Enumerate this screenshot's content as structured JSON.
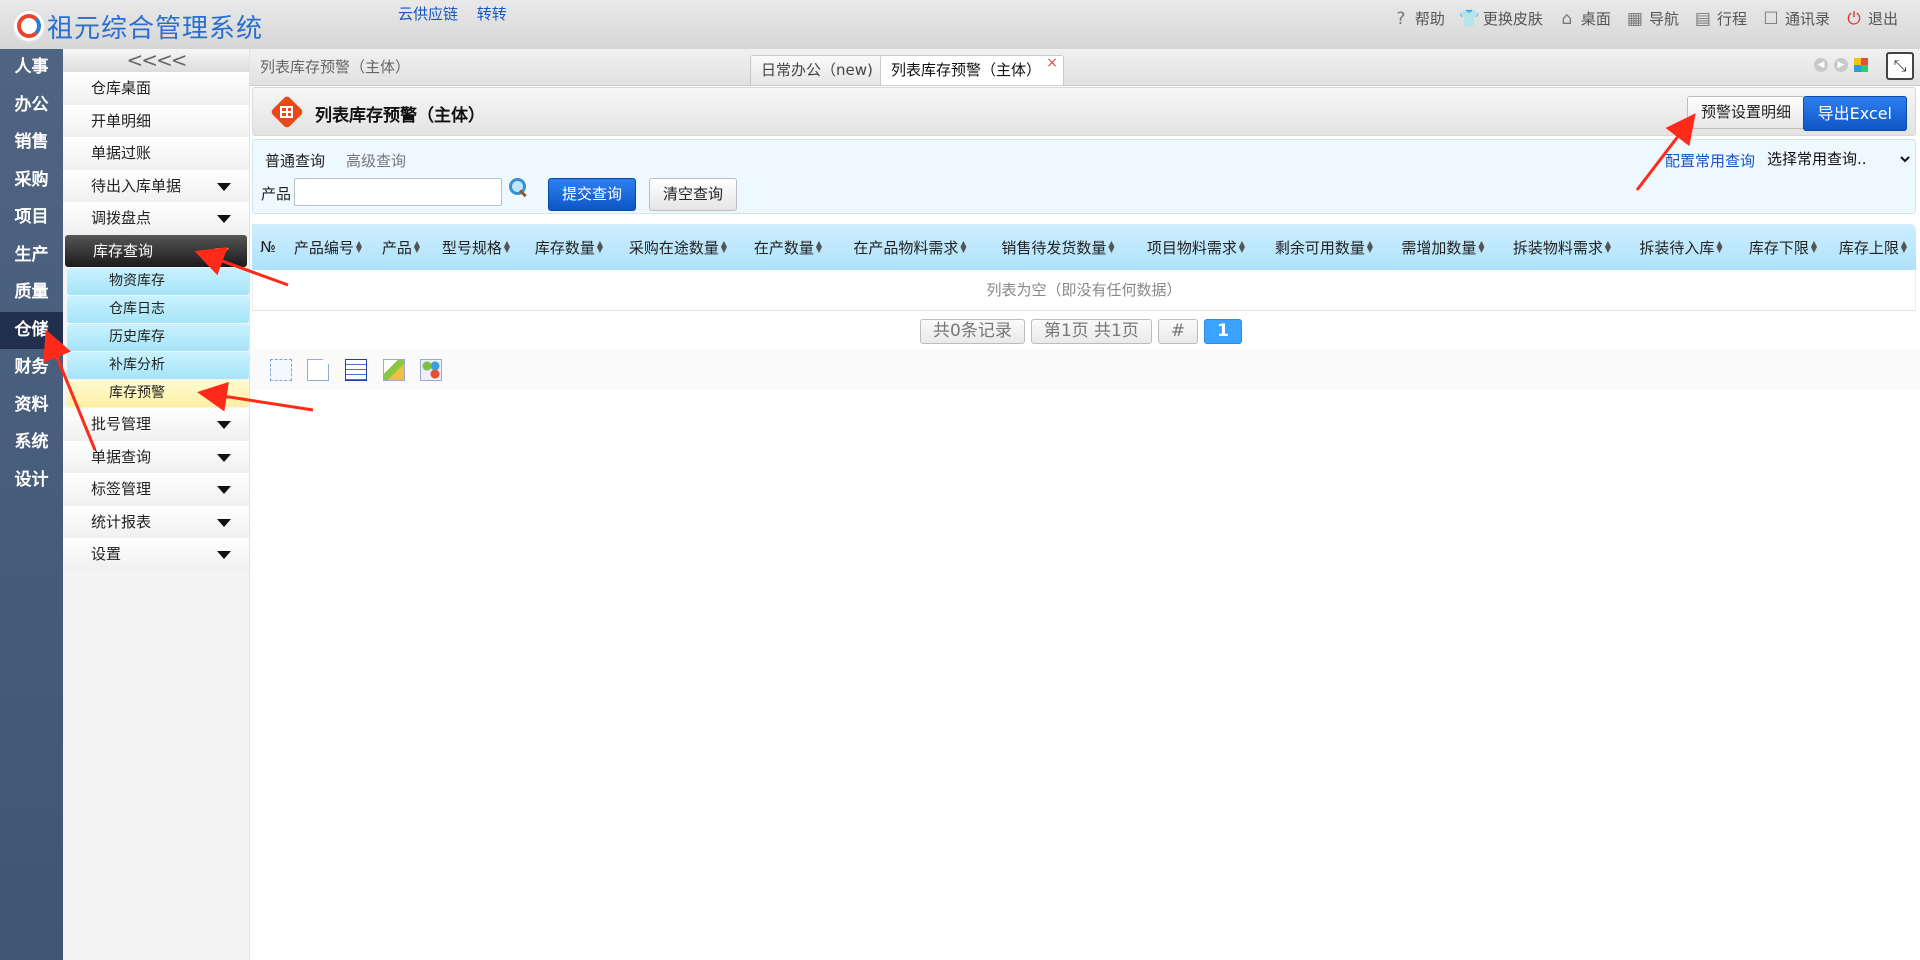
{
  "app": {
    "title": "祖元综合管理系统",
    "top_links": [
      "云供应链",
      "转转"
    ],
    "top_menu": [
      {
        "label": "帮助",
        "icon": "help-icon",
        "glyph": "?"
      },
      {
        "label": "更换皮肤",
        "icon": "shirt-icon",
        "glyph": "👕"
      },
      {
        "label": "桌面",
        "icon": "home-icon",
        "glyph": "⌂"
      },
      {
        "label": "导航",
        "icon": "nav-grid-icon",
        "glyph": "▦"
      },
      {
        "label": "行程",
        "icon": "calendar-icon",
        "glyph": "▤"
      },
      {
        "label": "通讯录",
        "icon": "contacts-icon",
        "glyph": "☐"
      },
      {
        "label": "退出",
        "icon": "power-icon",
        "glyph": "⏻"
      }
    ]
  },
  "categories": [
    "人事",
    "办公",
    "销售",
    "采购",
    "项目",
    "生产",
    "质量",
    "仓储",
    "财务",
    "资料",
    "系统",
    "设计"
  ],
  "active_category": "仓储",
  "menu": {
    "collapse_glyph": "<<<<",
    "items_top": [
      "仓库桌面",
      "开单明细",
      "单据过账"
    ],
    "items_expand1": [
      "待出入库单据",
      "调拨盘点"
    ],
    "active_group": "库存查询",
    "sub_items": [
      "物资库存",
      "仓库日志",
      "历史库存",
      "补库分析",
      "库存预警"
    ],
    "items_after": [
      "批号管理",
      "单据查询",
      "标签管理",
      "统计报表",
      "设置"
    ]
  },
  "tabs": {
    "breadcrumb": "列表库存预警（主体）",
    "list": [
      "日常办公（new)",
      "列表库存预警（主体）"
    ],
    "close_glyph": "×"
  },
  "page": {
    "title": "列表库存预警（主体）",
    "alert_button": "预警设置明细",
    "export_button": "导出Excel"
  },
  "query": {
    "tab_normal": "普通查询",
    "tab_advanced": "高级查询",
    "product_label": "产品",
    "product_value": "",
    "submit": "提交查询",
    "clear": "清空查询",
    "config_link": "配置常用查询",
    "select_value": "选择常用查询.."
  },
  "grid": {
    "columns": [
      "№",
      "产品编号",
      "产品",
      "型号规格",
      "库存数量",
      "采购在途数量",
      "在产数量",
      "在产品物料需求",
      "销售待发货数量",
      "项目物料需求",
      "剩余可用数量",
      "需增加数量",
      "拆装物料需求",
      "拆装待入库",
      "库存下限",
      "库存上限"
    ],
    "empty_text": "列表为空（即没有任何数据）"
  },
  "pager": {
    "records": "共0条记录",
    "pages": "第1页 共1页",
    "hash": "#",
    "current": "1"
  },
  "colors": {
    "accent": "#0d56c6",
    "sidebar": "#3e5575",
    "annotation": "#ff2a1a"
  }
}
